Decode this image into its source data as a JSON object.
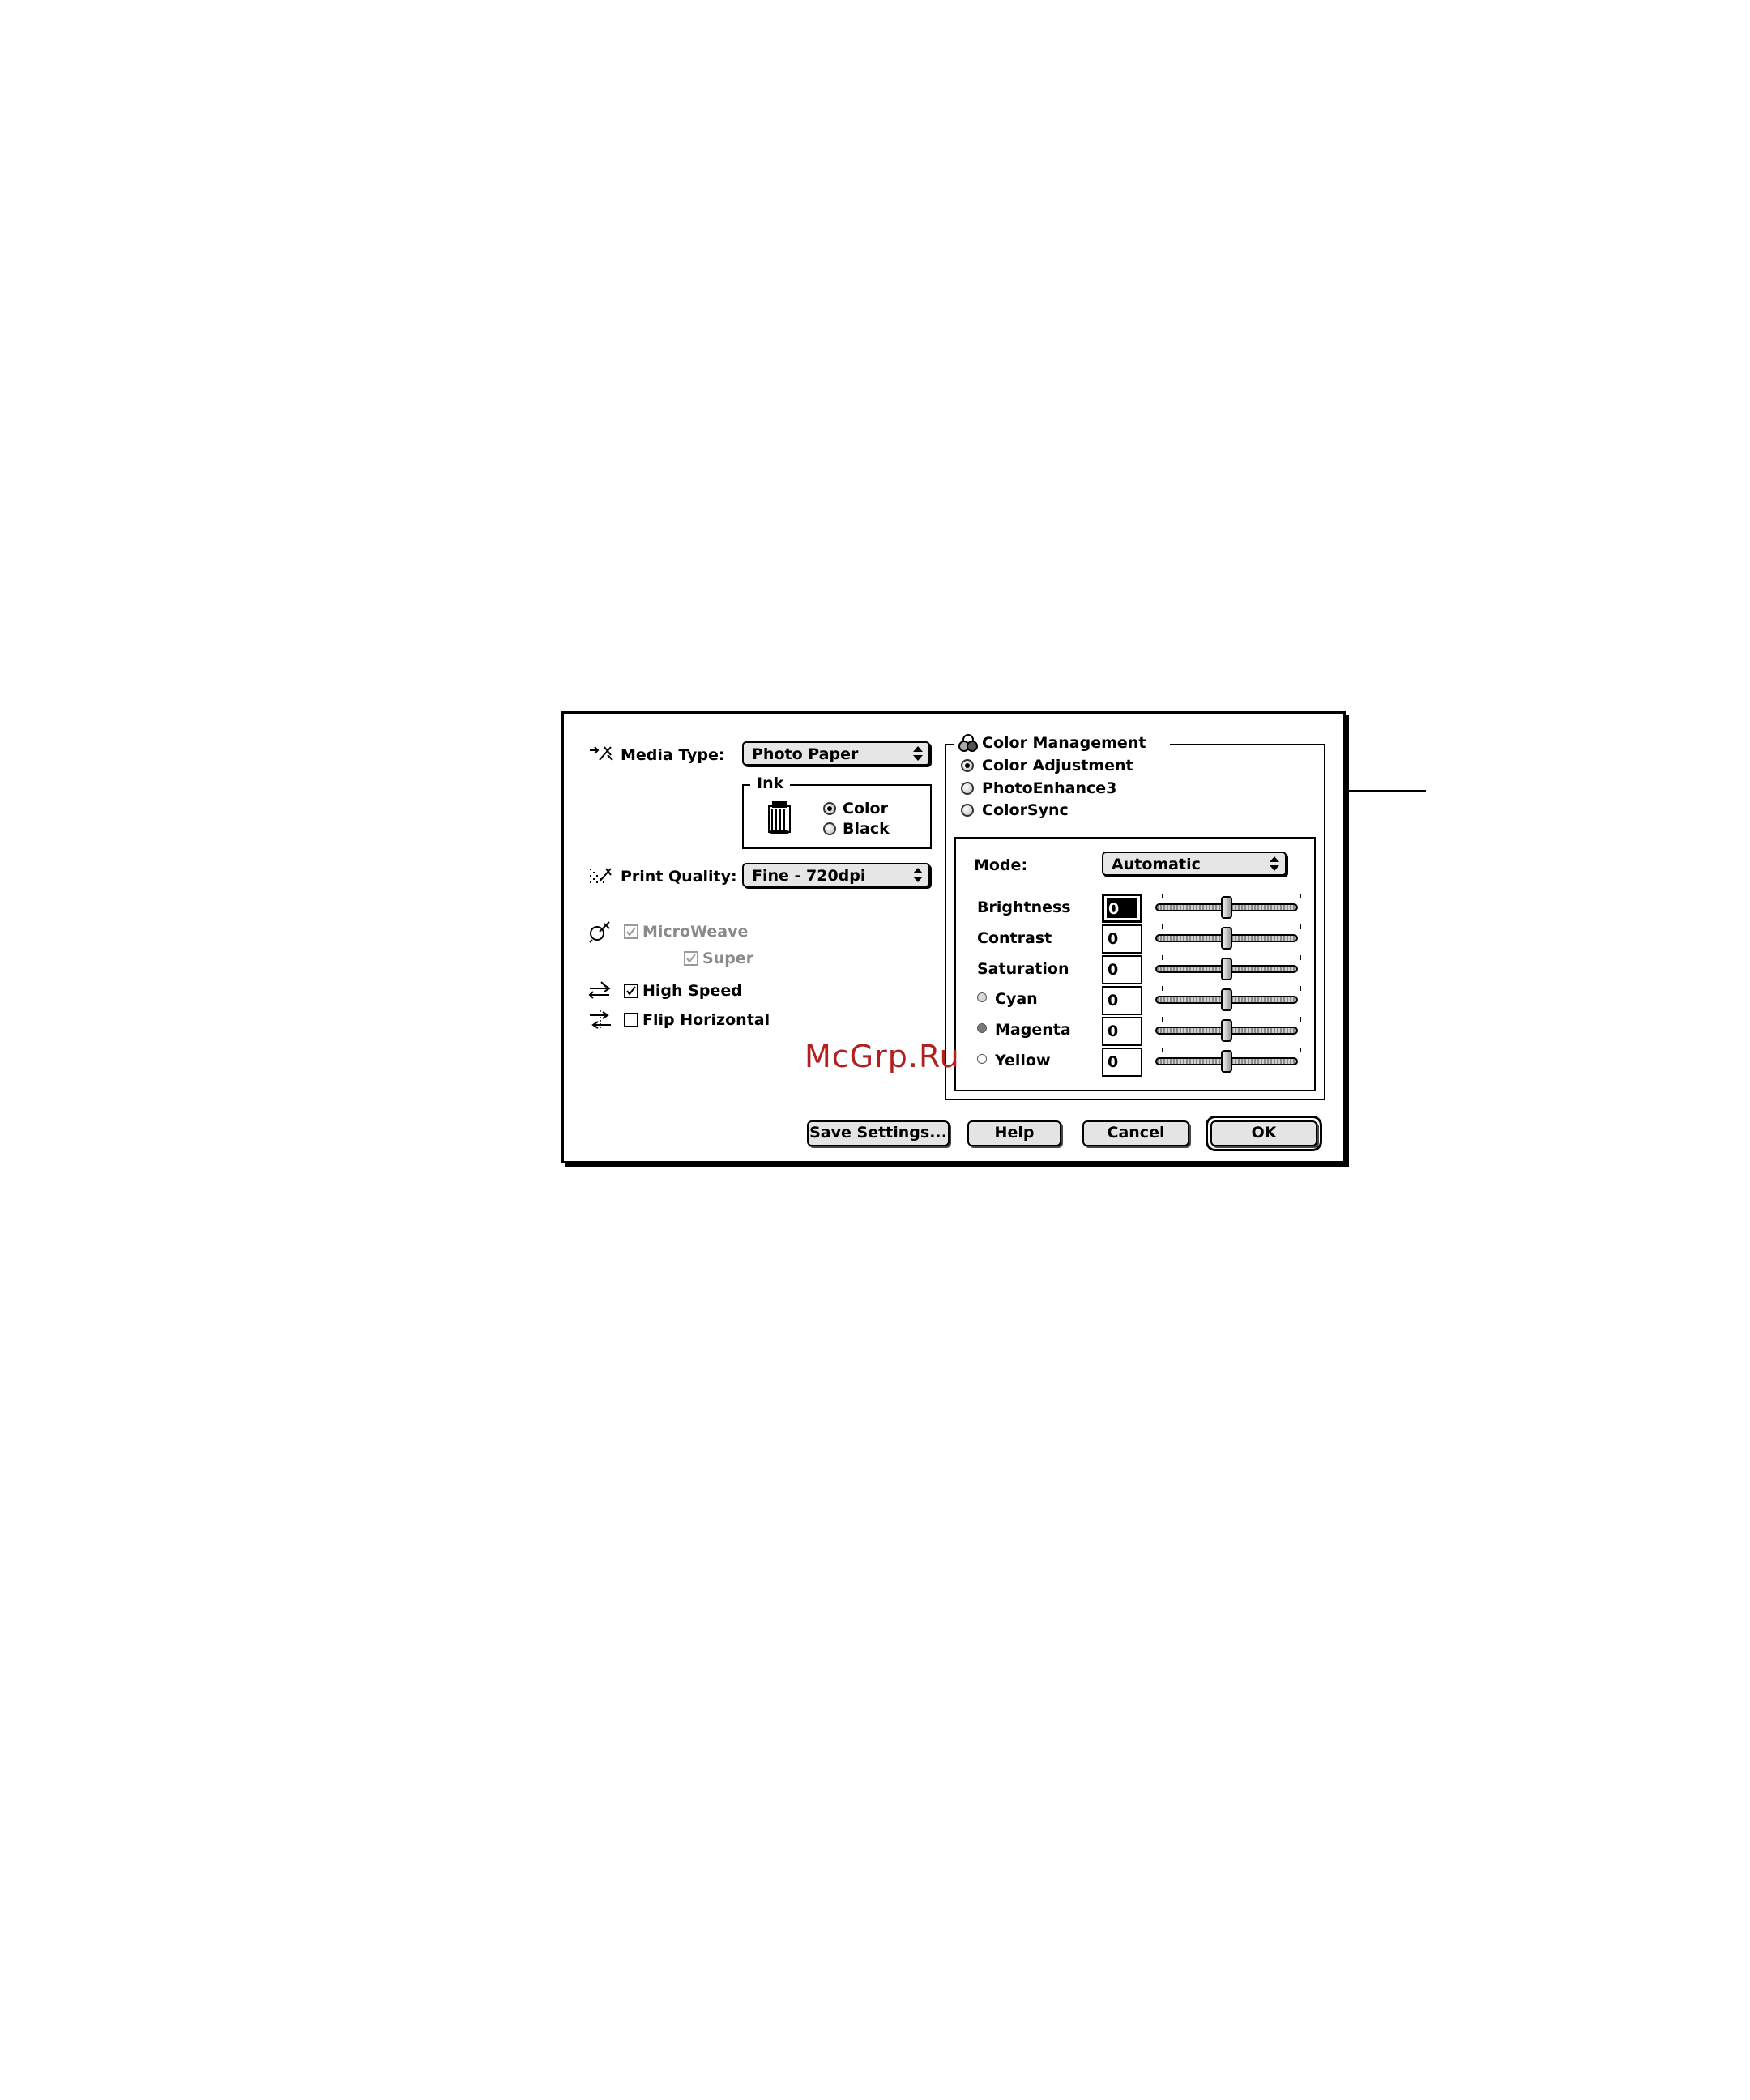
{
  "watermark": "McGrp.Ru",
  "dialog": {
    "media_type": {
      "label": "Media Type:",
      "value": "Photo Paper",
      "icon": "media-type-icon"
    },
    "ink": {
      "title": "Ink",
      "options": [
        "Color",
        "Black"
      ],
      "selected": "Color",
      "icon": "ink-cartridge-icon"
    },
    "print_quality": {
      "label": "Print Quality:",
      "value": "Fine - 720dpi",
      "icon": "print-quality-icon"
    },
    "microweave": {
      "label": "MicroWeave",
      "checked": true,
      "disabled": true
    },
    "super": {
      "label": "Super",
      "checked": true,
      "disabled": true
    },
    "high_speed": {
      "label": "High Speed",
      "checked": true
    },
    "flip_horizontal": {
      "label": "Flip Horizontal",
      "checked": false
    },
    "color_management": {
      "title": "Color Management",
      "options": [
        "Color Adjustment",
        "PhotoEnhance3",
        "ColorSync"
      ],
      "selected": "Color Adjustment"
    },
    "mode": {
      "label": "Mode:",
      "value": "Automatic"
    },
    "sliders": [
      {
        "label": "Brightness",
        "value": "0",
        "level": 0
      },
      {
        "label": "Contrast",
        "value": "0",
        "level": 0
      },
      {
        "label": "Saturation",
        "value": "0",
        "level": 0
      },
      {
        "label": "Cyan",
        "value": "0",
        "level": 0,
        "dot_color": "#d8d8d8"
      },
      {
        "label": "Magenta",
        "value": "0",
        "level": 0,
        "dot_color": "#7a7a7a"
      },
      {
        "label": "Yellow",
        "value": "0",
        "level": 0,
        "dot_color": "#ffffff"
      }
    ],
    "buttons": {
      "save_settings": "Save Settings...",
      "help": "Help",
      "cancel": "Cancel",
      "ok": "OK"
    }
  }
}
